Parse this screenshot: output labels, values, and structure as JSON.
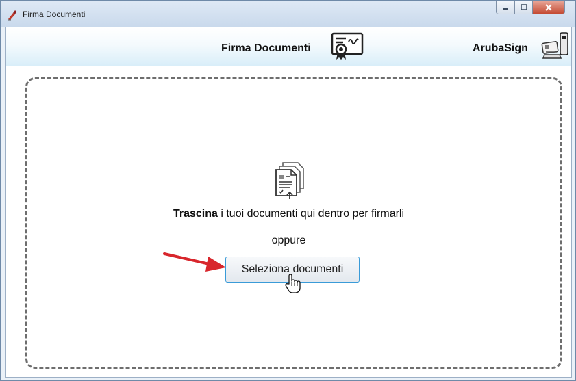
{
  "window": {
    "title": "Firma Documenti",
    "controls": {
      "minimize": "minimize-icon",
      "maximize": "maximize-icon",
      "close": "close-icon"
    }
  },
  "header": {
    "title": "Firma Documenti",
    "title_icon": "certificate-icon",
    "brand": "ArubaSign",
    "brand_icon": "smartcard-reader-icon"
  },
  "dropzone": {
    "icon": "documents-upload-icon",
    "drag_bold": "Trascina",
    "drag_rest": " i tuoi documenti qui dentro per firmarli",
    "or": "oppure",
    "select_button": "Seleziona documenti"
  },
  "annotations": {
    "arrow": "red-arrow-icon",
    "cursor": "hand-pointer-icon"
  },
  "colors": {
    "arrow": "#d8262c",
    "button_border": "#3a9bd8",
    "dash": "#6e6e6e"
  }
}
